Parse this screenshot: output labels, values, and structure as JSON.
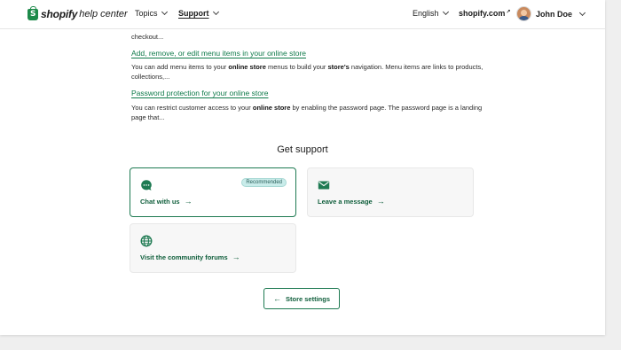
{
  "header": {
    "logo_brand": "shopify",
    "logo_sub": "help center",
    "nav": {
      "topics": "Topics",
      "support": "Support",
      "language": "English",
      "site": "shopify.com",
      "site_suffix": "↗"
    },
    "user_name": "John Doe"
  },
  "articles": {
    "prev_tail": "checkout...",
    "items": [
      {
        "title": "Add, remove, or edit menu items in your online store",
        "desc_parts": [
          "You can add menu items to your ",
          "online store",
          " menus to build your ",
          "store's",
          " navigation. Menu items are links to products, collections,..."
        ]
      },
      {
        "title": "Password protection for your online store",
        "desc_parts": [
          "You can restrict customer access to your ",
          "online store",
          " by enabling the password page. The password page is a landing page that..."
        ]
      }
    ]
  },
  "support": {
    "title": "Get support",
    "chat": {
      "label": "Chat with us",
      "badge": "Recommended",
      "icon": "chat-bubble-icon"
    },
    "message": {
      "label": "Leave a message",
      "icon": "envelope-icon"
    },
    "forums": {
      "label": "Visit the community forums",
      "icon": "globe-icon"
    },
    "arrow": "→"
  },
  "store_button": {
    "label": "Store settings",
    "arrow": "←"
  },
  "colors": {
    "accent_green": "#1e7a52",
    "link_green": "#0f7a4a",
    "badge_bg": "#c9ecea"
  }
}
